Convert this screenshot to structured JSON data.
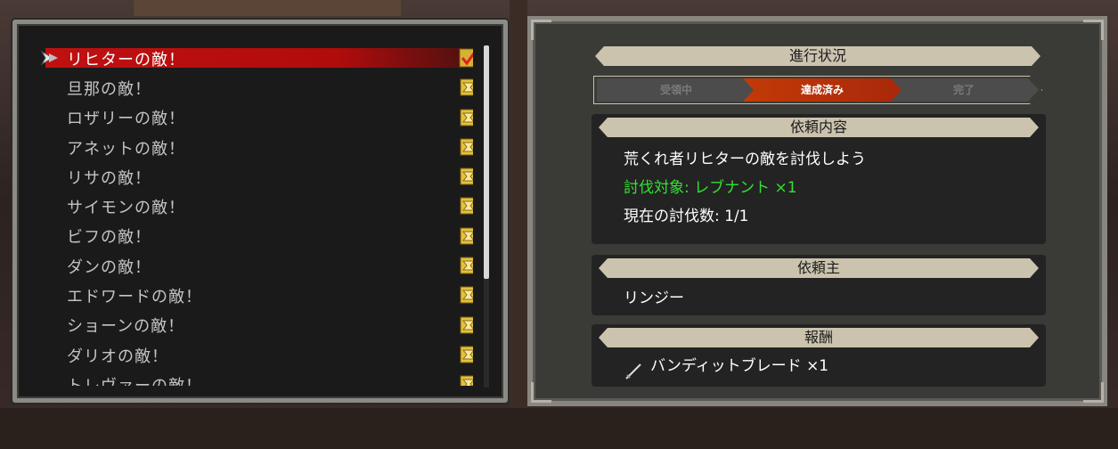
{
  "quest_list": {
    "items": [
      {
        "label": "リヒターの敵！",
        "selected": true,
        "status": "complete"
      },
      {
        "label": "旦那の敵！",
        "selected": false,
        "status": "available"
      },
      {
        "label": "ロザリーの敵！",
        "selected": false,
        "status": "available"
      },
      {
        "label": "アネットの敵！",
        "selected": false,
        "status": "available"
      },
      {
        "label": "リサの敵！",
        "selected": false,
        "status": "available"
      },
      {
        "label": "サイモンの敵！",
        "selected": false,
        "status": "available"
      },
      {
        "label": "ビフの敵！",
        "selected": false,
        "status": "available"
      },
      {
        "label": "ダンの敵！",
        "selected": false,
        "status": "available"
      },
      {
        "label": "エドワードの敵！",
        "selected": false,
        "status": "available"
      },
      {
        "label": "ショーンの敵！",
        "selected": false,
        "status": "available"
      },
      {
        "label": "ダリオの敵！",
        "selected": false,
        "status": "available"
      },
      {
        "label": "トレヴァーの敵！",
        "selected": false,
        "status": "available"
      }
    ]
  },
  "progress": {
    "title": "進行状況",
    "steps": [
      "受領中",
      "達成済み",
      "完了"
    ],
    "current_step": "達成済み"
  },
  "request": {
    "header": "依頼内容",
    "description": "荒くれ者リヒターの敵を討伐しよう",
    "target": "討伐対象: レブナント ×1",
    "current": "現在の討伐数: 1/1"
  },
  "client": {
    "header": "依頼主",
    "name": "リンジー"
  },
  "reward": {
    "header": "報酬",
    "item": "バンディットブレード ×1",
    "icon": "sword-icon"
  },
  "colors": {
    "selection": "#c01010",
    "active_step": "#c23a08",
    "target_text": "#33e033",
    "header_tan": "#cbc3ae"
  }
}
